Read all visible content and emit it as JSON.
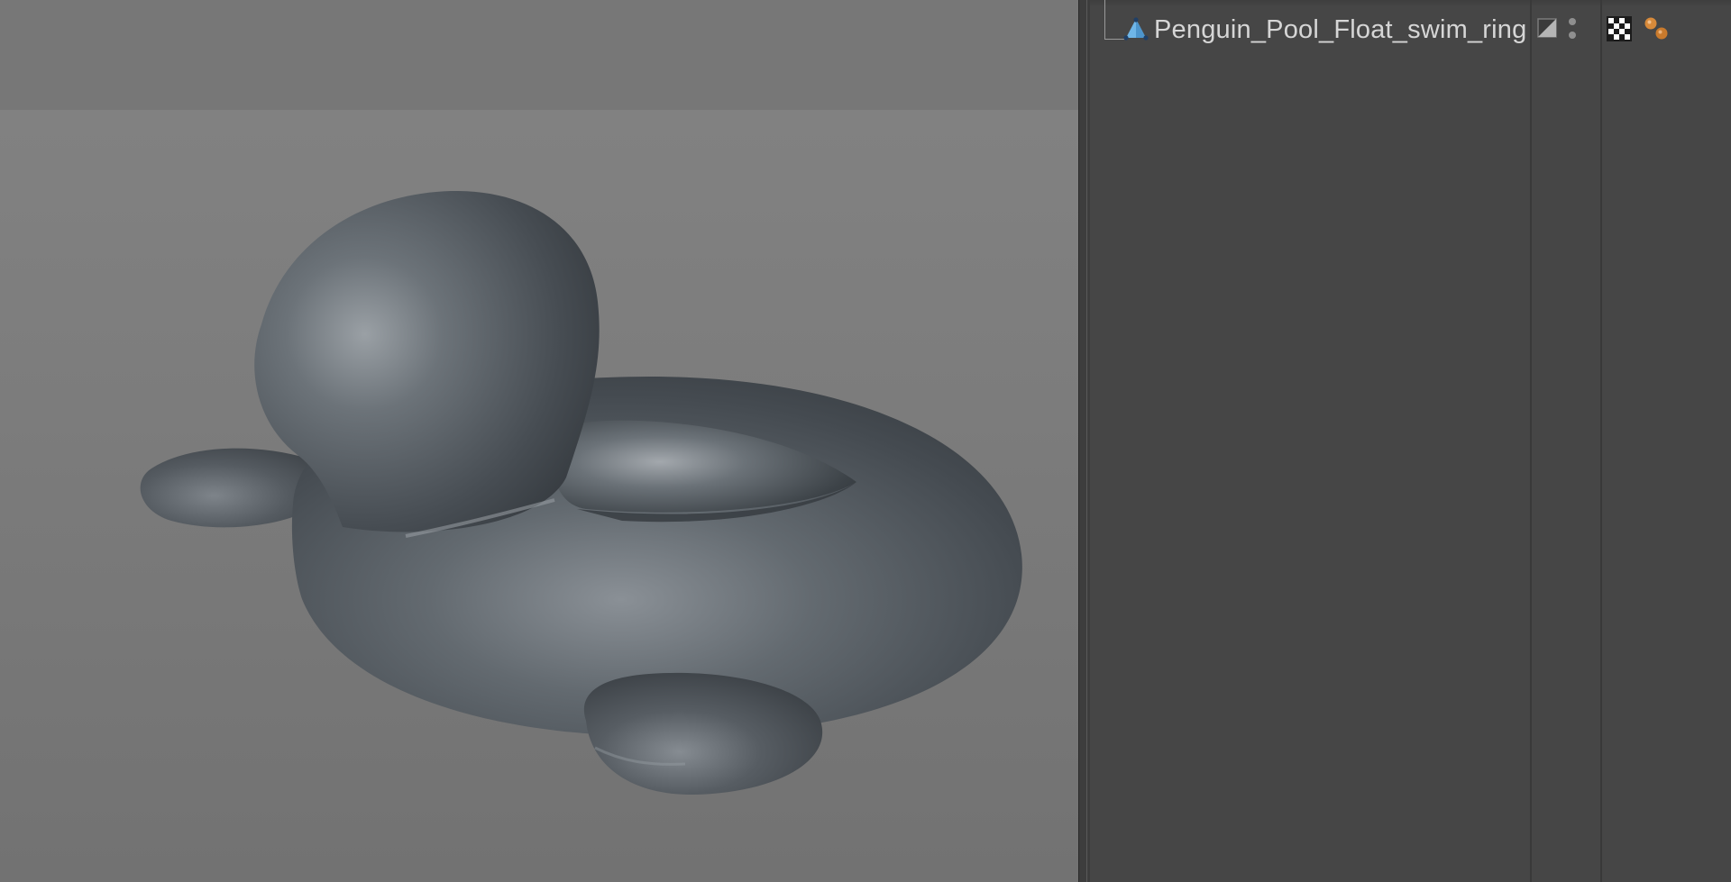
{
  "viewport": {
    "background_color": "#7d7d7d",
    "model_color": "#4f555b"
  },
  "object_manager": {
    "objects": [
      {
        "name": "Penguin_Pool_Float_swim_ring",
        "icon": "polygon-object-icon",
        "tags": [
          "material-tag-icon",
          "phong-tag-icon"
        ]
      }
    ]
  },
  "colors": {
    "panel_bg": "#464646",
    "text": "#d6d6d6",
    "phong_orange": "#d88a3a",
    "object_icon_blue": "#6fb6e8"
  }
}
